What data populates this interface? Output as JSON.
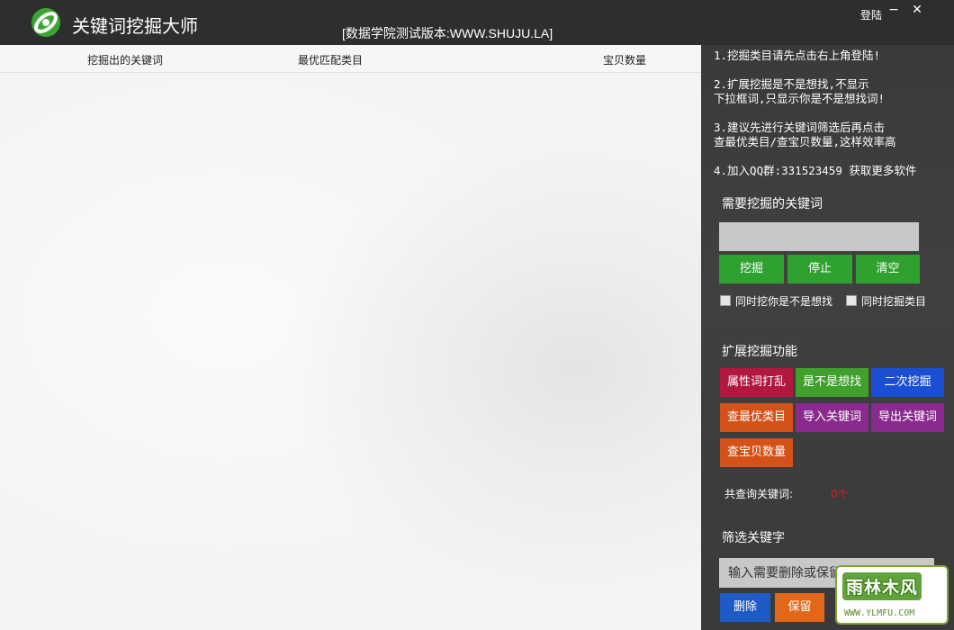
{
  "window": {
    "app_title": "关键词挖掘大师",
    "subtitle": "[数据学院测试版本:WWW.SHUJU.LA]",
    "login_label": "登陆",
    "minimize_glyph": "−",
    "close_glyph": "✕"
  },
  "results": {
    "columns": [
      "挖掘出的关键词",
      "最优匹配类目",
      "宝贝数量"
    ]
  },
  "tips": [
    "1.挖掘类目请先点击右上角登陆!",
    "2.扩展挖掘是不是想找,不显示\n下拉框词,只显示你是不是想找词!",
    "3.建议先进行关键词筛选后再点击\n查最优类目/查宝贝数量,这样效率高",
    "4.加入QQ群:331523459 获取更多软件"
  ],
  "mining": {
    "title": "需要挖掘的关键词",
    "input_value": "",
    "buttons": [
      "挖掘",
      "停止",
      "清空"
    ],
    "checkboxes": [
      {
        "label": "同时挖你是不是想找",
        "checked": false
      },
      {
        "label": "同时挖掘类目",
        "checked": false
      }
    ]
  },
  "extended": {
    "title": "扩展挖掘功能",
    "buttons": [
      {
        "label": "属性词打乱",
        "color": "#b2173f"
      },
      {
        "label": "是不是想找",
        "color": "#3fa12b"
      },
      {
        "label": "二次挖掘",
        "color": "#1a4ed3"
      },
      {
        "label": "查最优类目",
        "color": "#d5511a"
      },
      {
        "label": "导入关键词",
        "color": "#8a2a8e"
      },
      {
        "label": "导出关键词",
        "color": "#8a2a8e"
      },
      {
        "label": "查宝贝数量",
        "color": "#d5511a"
      }
    ],
    "stats_label": "共查询关键词:",
    "stats_value": "0个"
  },
  "filter": {
    "title": "筛选关键字",
    "placeholder": "输入需要删除或保留的词",
    "buttons": [
      "删除",
      "保留"
    ]
  },
  "watermark": {
    "text": "雨林木风",
    "url": "WWW.YLMFU.COM"
  }
}
